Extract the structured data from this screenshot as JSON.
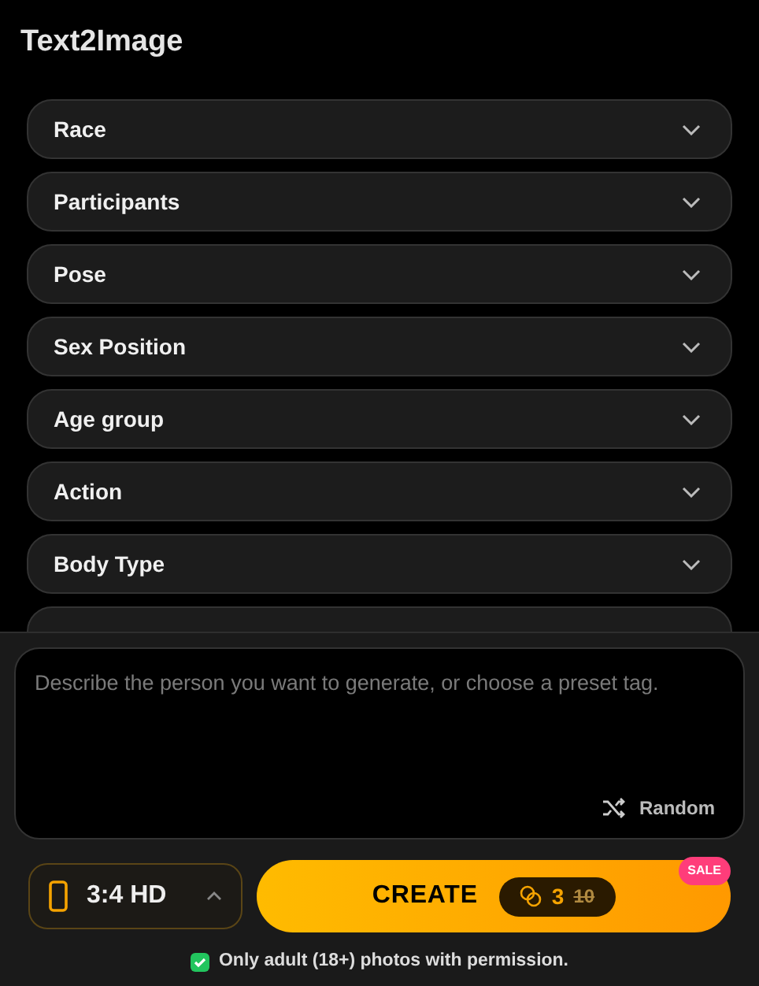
{
  "title": "Text2Image",
  "filters": [
    {
      "label": "Race",
      "expanded": false
    },
    {
      "label": "Participants",
      "expanded": false
    },
    {
      "label": "Pose",
      "expanded": false
    },
    {
      "label": "Sex Position",
      "expanded": false
    },
    {
      "label": "Age group",
      "expanded": false
    },
    {
      "label": "Action",
      "expanded": false
    },
    {
      "label": "Body Type",
      "expanded": false
    }
  ],
  "prompt": {
    "placeholder": "Describe the person you want to generate, or choose a preset tag.",
    "random_label": "Random"
  },
  "aspect": {
    "label": "3:4 HD",
    "expanded": false
  },
  "create": {
    "label": "CREATE",
    "cost": "3",
    "old_cost": "10",
    "badge": "SALE"
  },
  "notice": {
    "text": "Only adult (18+) photos with permission.",
    "checked": true
  }
}
